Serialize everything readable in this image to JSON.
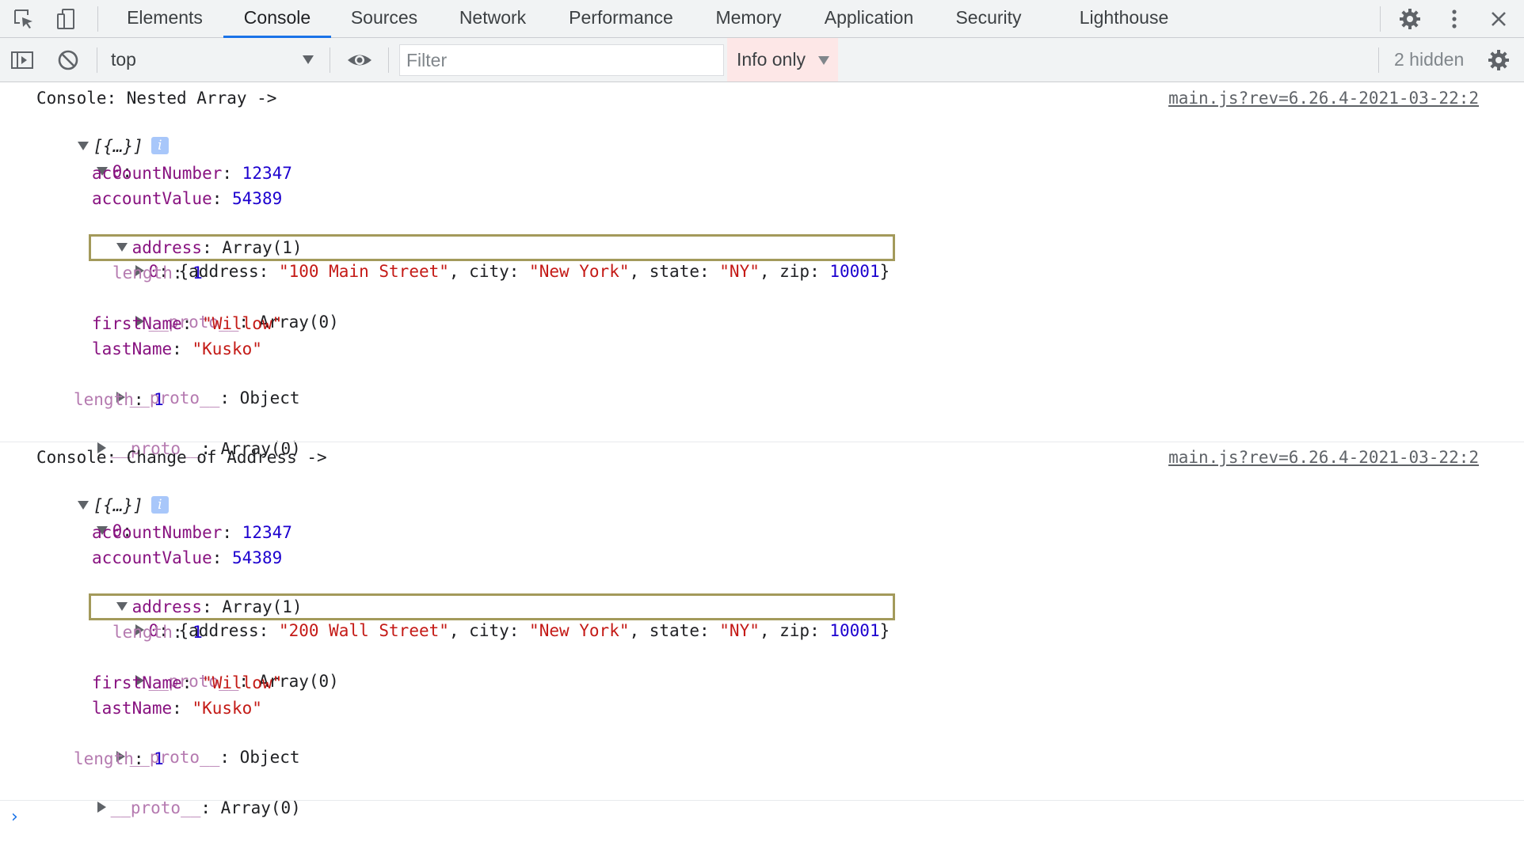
{
  "tabs": [
    {
      "label": "Elements",
      "active": false
    },
    {
      "label": "Console",
      "active": true
    },
    {
      "label": "Sources",
      "active": false
    },
    {
      "label": "Network",
      "active": false
    },
    {
      "label": "Performance",
      "active": false
    },
    {
      "label": "Memory",
      "active": false
    },
    {
      "label": "Application",
      "active": false
    },
    {
      "label": "Security",
      "active": false
    },
    {
      "label": "Lighthouse",
      "active": false
    }
  ],
  "toolbar": {
    "context": "top",
    "filter_placeholder": "Filter",
    "filter_value": "",
    "log_level": "Info only",
    "hidden_count": "2 hidden"
  },
  "messages": [
    {
      "header": "Console: Nested Array ->",
      "source": "main.js?rev=6.26.4-2021-03-22:2",
      "preview": "[{…}]",
      "item_index": "0",
      "accountNumber": "12347",
      "accountValue": "54389",
      "address_summary": "Array(1)",
      "address_entry": {
        "address": "\"100 Main Street\"",
        "city": "\"New York\"",
        "state": "\"NY\"",
        "zip": "10001"
      },
      "address_length": "1",
      "address_proto": "Array(0)",
      "firstName": "\"Willow\"",
      "lastName": "\"Kusko\"",
      "object_proto": "Object",
      "array_length": "1",
      "array_proto": "Array(0)"
    },
    {
      "header": "Console: Change of Address ->",
      "source": "main.js?rev=6.26.4-2021-03-22:2",
      "preview": "[{…}]",
      "item_index": "0",
      "accountNumber": "12347",
      "accountValue": "54389",
      "address_summary": "Array(1)",
      "address_entry": {
        "address": "\"200 Wall Street\"",
        "city": "\"New York\"",
        "state": "\"NY\"",
        "zip": "10001"
      },
      "address_length": "1",
      "address_proto": "Array(0)",
      "firstName": "\"Willow\"",
      "lastName": "\"Kusko\"",
      "object_proto": "Object",
      "array_length": "1",
      "array_proto": "Array(0)"
    }
  ],
  "icons": {
    "inspect": "inspect-element-icon",
    "device": "device-toolbar-icon",
    "settings": "gear-icon",
    "more": "more-vertical-icon",
    "close": "close-icon",
    "sidebar": "show-sidebar-icon",
    "clear": "clear-console-icon",
    "eye": "live-expression-eye-icon",
    "console_settings": "console-settings-gear-icon",
    "prompt": "console-prompt-chevron-icon"
  },
  "colors": {
    "active_tab": "#1a73e8",
    "highlight_box": "#a39a5b",
    "property_key": "#881280",
    "number": "#1c00cf",
    "string": "#c41a16"
  }
}
